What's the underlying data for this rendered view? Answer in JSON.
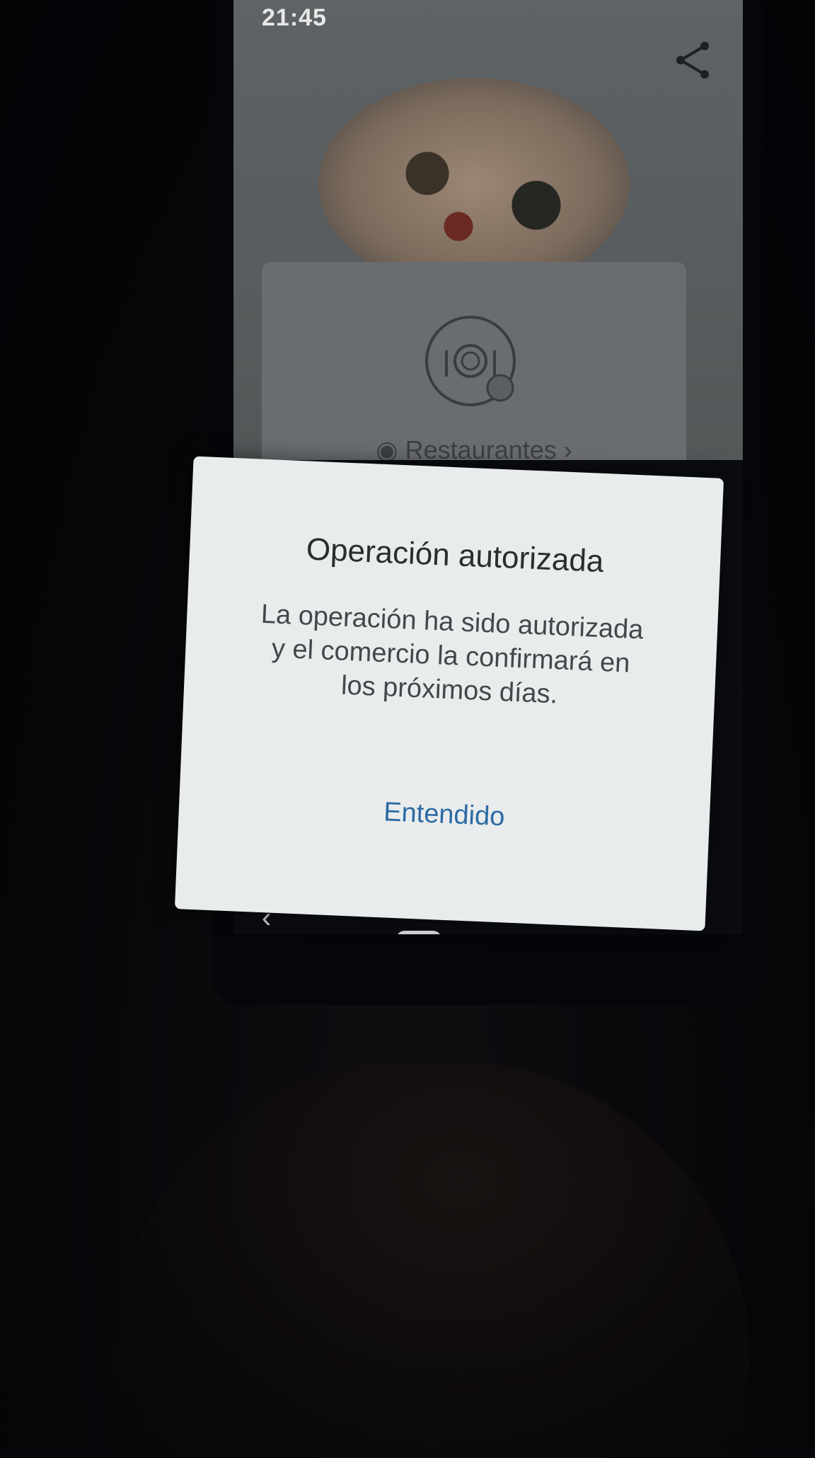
{
  "status_bar": {
    "time": "21:45"
  },
  "category_card": {
    "label": "Restaurantes",
    "chevron": "›"
  },
  "dialog": {
    "title": "Operación autorizada",
    "message": "La operación ha sido autorizada y el comercio la confirmará en los próximos días.",
    "confirm_label": "Entendido"
  },
  "nav": {
    "back_glyph": "‹"
  },
  "icons": {
    "share": "share-icon",
    "restaurant": "restaurant-plate-icon",
    "category": "category-badge-icon"
  },
  "colors": {
    "accent": "#2c6aa3",
    "dialog_bg": "#e9ecec"
  }
}
